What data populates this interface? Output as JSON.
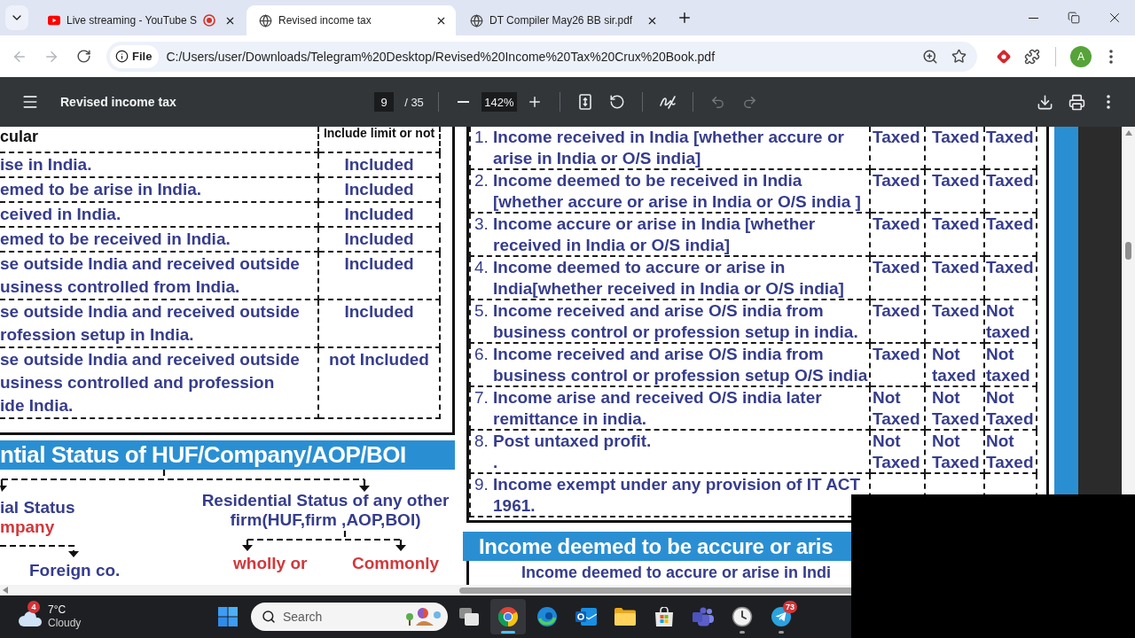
{
  "tabs": [
    {
      "kind": "youtube",
      "title": "Live streaming - YouTube S",
      "recording": true,
      "selected": false
    },
    {
      "kind": "page",
      "title": "Revised income tax",
      "recording": false,
      "selected": true
    },
    {
      "kind": "page",
      "title": "DT Compiler May26 BB sir.pdf",
      "recording": false,
      "selected": false
    }
  ],
  "navigation": {
    "back_disabled": true,
    "forward_disabled": true
  },
  "address_bar": {
    "site_chip": "File",
    "url": "C:/Users/user/Downloads/Telegram%20Desktop/Revised%20Income%20Tax%20Crux%20Book.pdf"
  },
  "profile": {
    "initial": "A"
  },
  "pdf_toolbar": {
    "title": "Revised income tax",
    "page": "9",
    "page_total": "/ 35",
    "zoom": "142%",
    "undo_disabled": true,
    "redo_disabled": true
  },
  "left_table": {
    "columns": [
      "cular",
      "Include limit or not"
    ],
    "rows": [
      {
        "lines": [
          "ise in India."
        ],
        "status": "Included"
      },
      {
        "lines": [
          "emed to be arise in India."
        ],
        "status": "Included"
      },
      {
        "lines": [
          "ceived in India."
        ],
        "status": "Included"
      },
      {
        "lines": [
          "emed to be received in India."
        ],
        "status": "Included"
      },
      {
        "lines": [
          "se outside India and received outside",
          "usiness controlled from India."
        ],
        "status": "Included"
      },
      {
        "lines": [
          "se outside India and received outside",
          "rofession setup in India."
        ],
        "status": "Included"
      },
      {
        "lines": [
          "se outside India and received outside",
          "usiness controlled and profession",
          "ide India."
        ],
        "status": "not Included"
      }
    ]
  },
  "status_section": {
    "title": "ntial Status of HUF/Company/AOP/BOI",
    "labels": [
      {
        "lines": [
          "ial Status"
        ],
        "color": "#363d8c"
      },
      {
        "lines": [
          "mpany"
        ],
        "color": "#d2383b"
      },
      {
        "lines": [
          "Residential Status of any other",
          "firm(HUF,firm ,AOP,BOI)"
        ],
        "color": "#363d8c"
      },
      {
        "lines": [
          "Foreign co."
        ],
        "color": "#363d8c"
      },
      {
        "lines": [
          "wholly or"
        ],
        "color": "#d2383b"
      },
      {
        "lines": [
          "Commonly"
        ],
        "color": "#d2383b"
      }
    ]
  },
  "right_table": {
    "rows": [
      {
        "number": "1.",
        "lines": [
          "Income received in India [whether accure or",
          "arise in India or O/S india]"
        ],
        "cells": [
          "Taxed",
          "Taxed",
          "Taxed"
        ]
      },
      {
        "number": "2.",
        "lines": [
          "Income deemed to be received in India",
          "[whether accure or arise in India or O/S india ]"
        ],
        "cells": [
          "Taxed",
          "Taxed",
          "Taxed"
        ]
      },
      {
        "number": "3.",
        "lines": [
          "Income accure or arise in India [whether",
          "received in India or O/S india]"
        ],
        "cells": [
          "Taxed",
          "Taxed",
          "Taxed"
        ]
      },
      {
        "number": "4.",
        "lines": [
          "Income deemed to accure or arise in",
          "India[whether received in India or O/S india]"
        ],
        "cells": [
          "Taxed",
          "Taxed",
          "Taxed"
        ]
      },
      {
        "number": "5.",
        "lines": [
          "Income received and arise O/S india from",
          "business control or profession setup in india."
        ],
        "cells": [
          "Taxed",
          "Taxed",
          "Not taxed"
        ]
      },
      {
        "number": "6.",
        "lines": [
          "Income received and arise O/S india from",
          "business control or profession setup O/S india"
        ],
        "cells": [
          "Taxed",
          "Not taxed",
          "Not taxed"
        ]
      },
      {
        "number": "7.",
        "lines": [
          "Income arise and received O/S india later",
          "remittance in india."
        ],
        "cells": [
          "Not Taxed",
          "Not Taxed",
          "Not Taxed"
        ]
      },
      {
        "number": "8.",
        "lines": [
          "Post untaxed profit.",
          "."
        ],
        "cells": [
          "Not Taxed",
          "Not Taxed",
          "Not Taxed"
        ]
      },
      {
        "number": "9.",
        "lines": [
          "Income exempt under any provision of IT ACT",
          "1961."
        ]
      }
    ]
  },
  "lower_section": {
    "title": "Income deemed to be accure or aris",
    "line": "Income deemed to accure or arise in Indi"
  },
  "taskbar": {
    "weather": {
      "temperature": "7°C",
      "condition": "Cloudy",
      "badge": "4"
    },
    "search": {
      "placeholder": "Search"
    },
    "apps": [
      {
        "kind": "task-view",
        "running": false,
        "selected": false
      },
      {
        "kind": "chrome",
        "running": true,
        "selected": true
      },
      {
        "kind": "edge",
        "running": false,
        "selected": false
      },
      {
        "kind": "outlook",
        "running": false,
        "selected": false
      },
      {
        "kind": "files",
        "running": false,
        "selected": false
      },
      {
        "kind": "store",
        "running": false,
        "selected": false
      },
      {
        "kind": "teams",
        "running": false,
        "selected": false
      },
      {
        "kind": "clock",
        "running": true,
        "selected": false
      },
      {
        "kind": "telegram",
        "running": true,
        "selected": false,
        "badge": "73"
      }
    ]
  }
}
